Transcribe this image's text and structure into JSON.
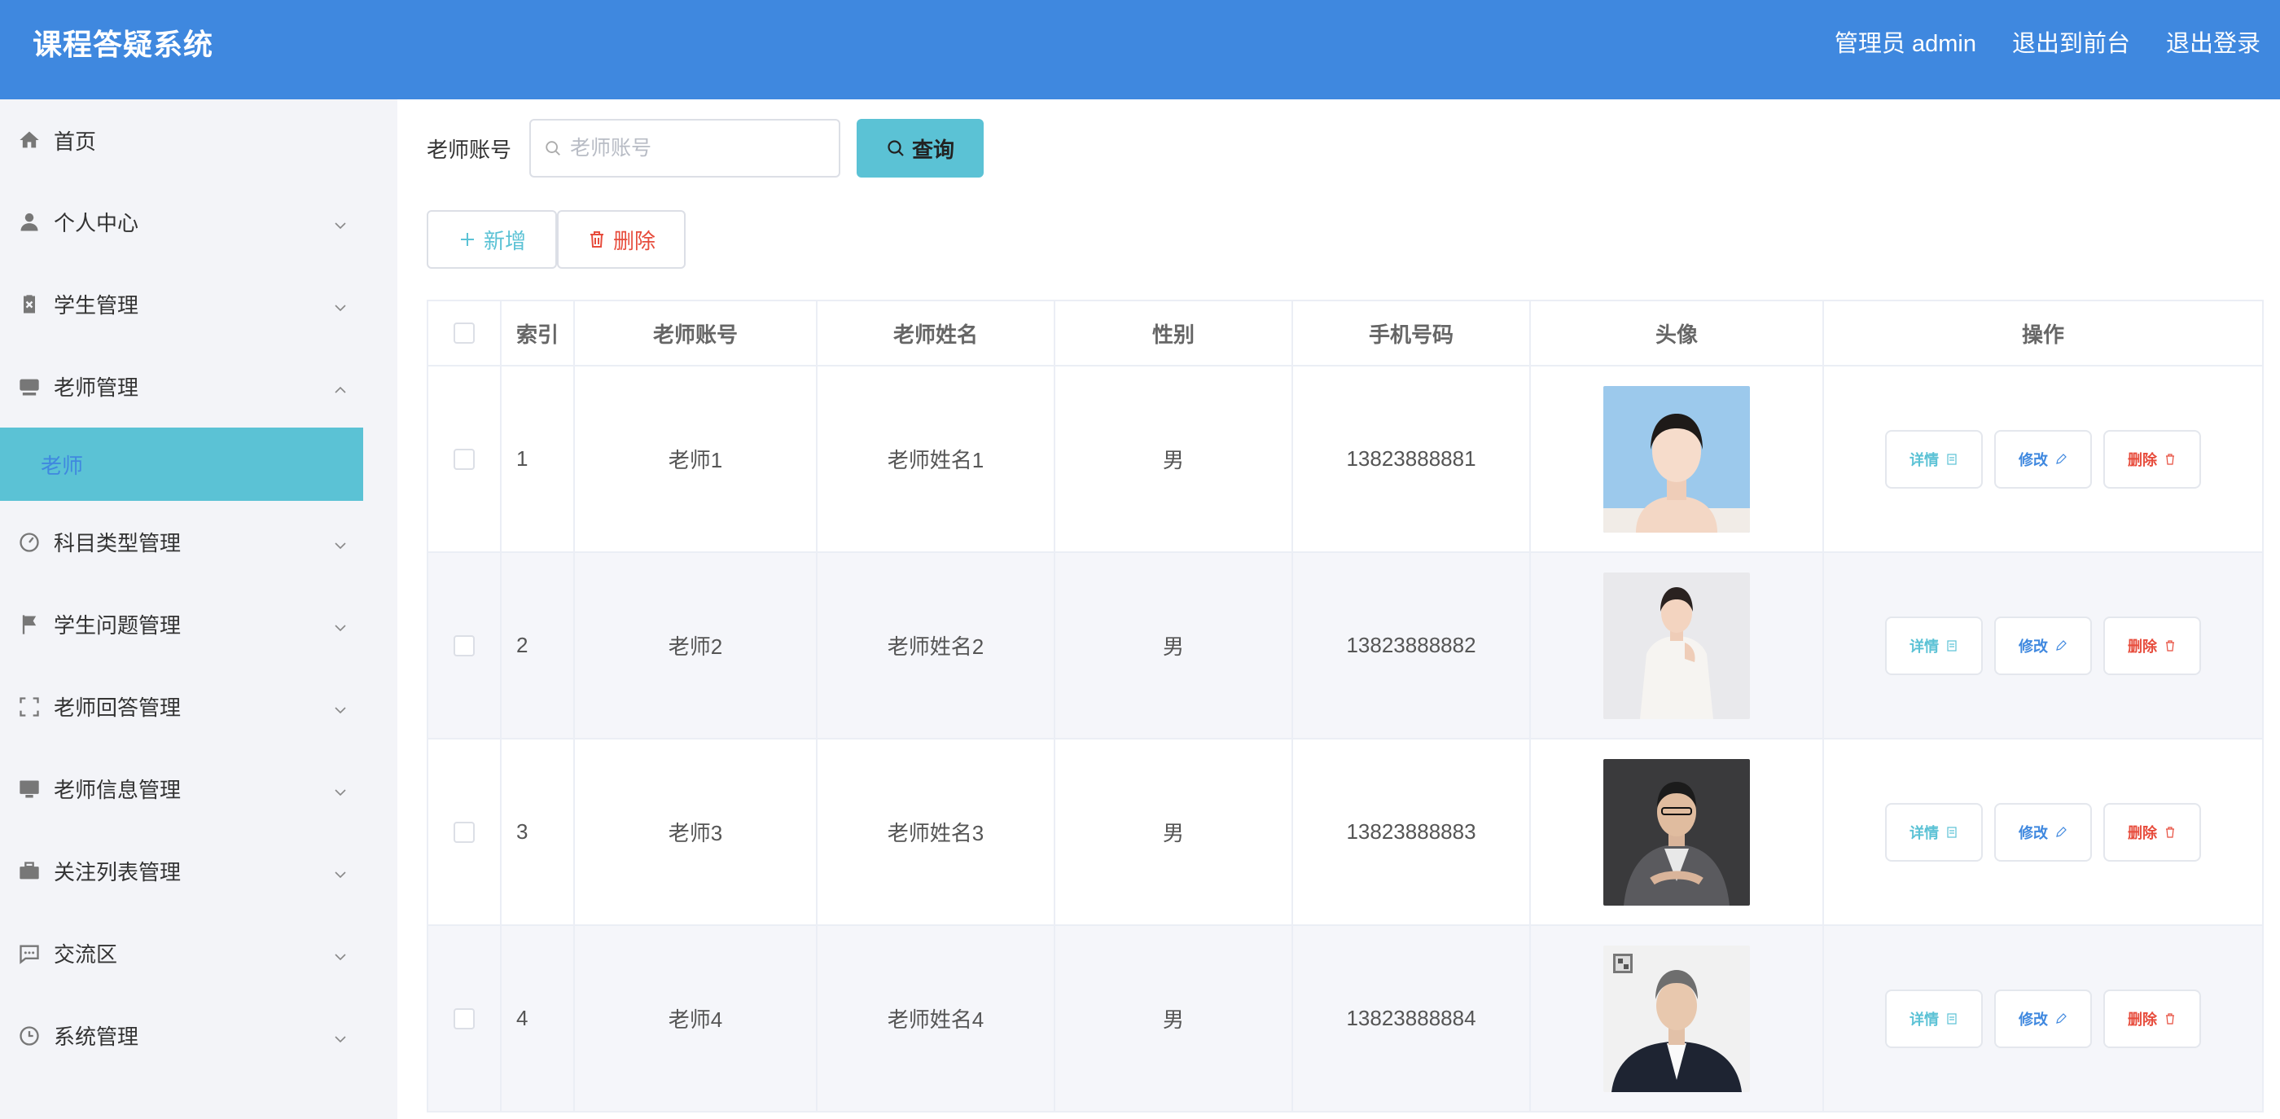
{
  "header": {
    "title": "课程答疑系统",
    "actions": [
      "管理员 admin",
      "退出到前台",
      "退出登录"
    ]
  },
  "sidebar": {
    "items": [
      {
        "label": "首页",
        "icon": "home-icon",
        "expandable": false
      },
      {
        "label": "个人中心",
        "icon": "user-icon",
        "expandable": true
      },
      {
        "label": "学生管理",
        "icon": "clipboard-icon",
        "expandable": true
      },
      {
        "label": "老师管理",
        "icon": "monitor-icon",
        "expandable": true,
        "expanded": true,
        "children": [
          "老师"
        ]
      },
      {
        "label": "科目类型管理",
        "icon": "gauge-icon",
        "expandable": true
      },
      {
        "label": "学生问题管理",
        "icon": "flag-icon",
        "expandable": true
      },
      {
        "label": "老师回答管理",
        "icon": "frame-icon",
        "expandable": true
      },
      {
        "label": "老师信息管理",
        "icon": "screen-icon",
        "expandable": true
      },
      {
        "label": "关注列表管理",
        "icon": "briefcase-icon",
        "expandable": true
      },
      {
        "label": "交流区",
        "icon": "chat-icon",
        "expandable": true
      },
      {
        "label": "系统管理",
        "icon": "clock-icon",
        "expandable": true
      }
    ]
  },
  "search": {
    "label": "老师账号",
    "placeholder": "老师账号",
    "value": "",
    "button": "查询"
  },
  "toolbar": {
    "add_label": "新增",
    "delete_label": "删除"
  },
  "table": {
    "columns": [
      "",
      "索引",
      "老师账号",
      "老师姓名",
      "性别",
      "手机号码",
      "头像",
      "操作"
    ],
    "rows": [
      {
        "index": "1",
        "account": "老师1",
        "name": "老师姓名1",
        "sex": "男",
        "phone": "13823888881"
      },
      {
        "index": "2",
        "account": "老师2",
        "name": "老师姓名2",
        "sex": "男",
        "phone": "13823888882"
      },
      {
        "index": "3",
        "account": "老师3",
        "name": "老师姓名3",
        "sex": "男",
        "phone": "13823888883"
      },
      {
        "index": "4",
        "account": "老师4",
        "name": "老师姓名4",
        "sex": "男",
        "phone": "13823888884"
      }
    ],
    "ops": {
      "detail": "详情",
      "edit": "修改",
      "delete": "删除"
    }
  },
  "colors": {
    "header_bg": "#3f88df",
    "accent": "#5bc2d5",
    "danger": "#e74c3c",
    "primary": "#3f88df"
  }
}
